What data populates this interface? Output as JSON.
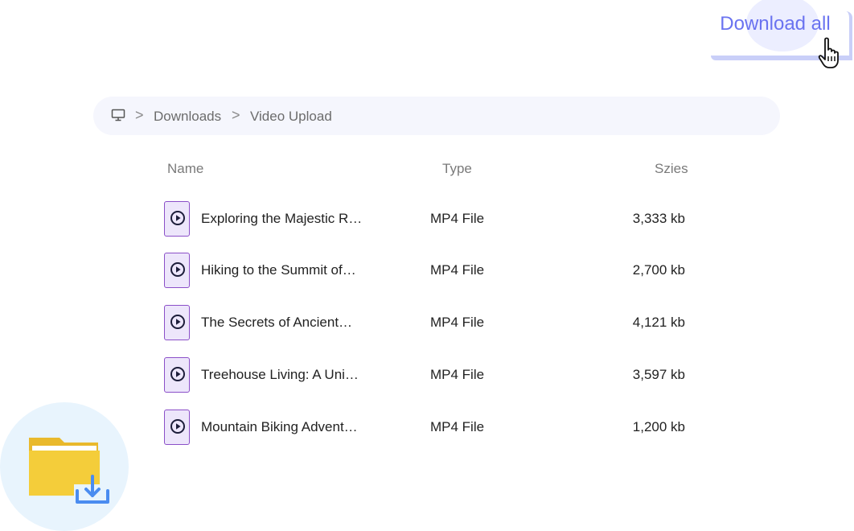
{
  "toolbar": {
    "download_all_label": "Download all"
  },
  "breadcrumb": {
    "root_icon": "monitor-icon",
    "separator": ">",
    "items": [
      "Downloads",
      "Video Upload"
    ]
  },
  "table": {
    "headers": {
      "name": "Name",
      "type": "Type",
      "size": "Szies"
    },
    "rows": [
      {
        "name": "Exploring the Majestic R…",
        "type": "MP4 File",
        "size": "3,333 kb"
      },
      {
        "name": "Hiking to the Summit of…",
        "type": "MP4 File",
        "size": "2,700 kb"
      },
      {
        "name": "The Secrets of Ancient…",
        "type": "MP4 File",
        "size": "4,121 kb"
      },
      {
        "name": "Treehouse Living: A Uni…",
        "type": "MP4 File",
        "size": "3,597 kb"
      },
      {
        "name": "Mountain Biking Advent…",
        "type": "MP4 File",
        "size": "1,200 kb"
      }
    ]
  },
  "colors": {
    "accent": "#6a73f0",
    "file_icon_border": "#8b4fc8",
    "folder": "#f4cd3a",
    "download_arrow": "#4a8cf0"
  }
}
